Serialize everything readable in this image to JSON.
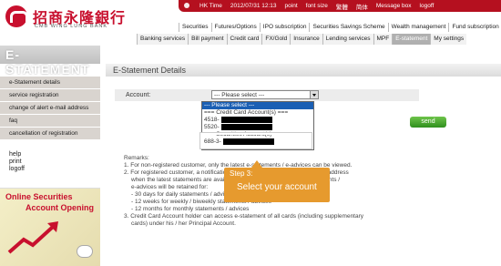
{
  "brand": {
    "name_cn": "招商永隆銀行",
    "name_en": "CMB WING LUNG BANK"
  },
  "topbar": {
    "time_label": "HK Time",
    "time_value": "2012/07/31 12:13",
    "items": [
      "point",
      "font size",
      "繁體",
      "简体",
      "Message box",
      "logoff"
    ]
  },
  "nav_row1": [
    "Securities",
    "Futures/Options",
    "IPO subscription",
    "Securities Savings Scheme",
    "Wealth management",
    "Fund subscription"
  ],
  "nav_row2": [
    "Banking services",
    "Bill payment",
    "Credit card",
    "FX/Gold",
    "Insurance",
    "Lending services",
    "MPF",
    "E-statement",
    "My settings"
  ],
  "nav_active": "E-statement",
  "sidebar": {
    "banner": "E-STATEMENT",
    "menu": [
      "e-Statement details",
      "service registration",
      "change of alert e-mail address",
      "faq",
      "cancellation of registration"
    ],
    "links": [
      "help",
      "print",
      "logoff"
    ],
    "promo_line1": "Online Securities",
    "promo_line2": "Account Opening"
  },
  "main": {
    "title": "E-Statement Details",
    "account_label": "Account:",
    "select_value": "--- Please select ---",
    "dropdown": [
      "--- Please select ---",
      "=== Credit Card Account(s) ===",
      "4518-",
      "5520-",
      "=== Securities Account(s) ===",
      "688-3-"
    ],
    "send_label": "send",
    "remarks_title": "Remarks:",
    "remarks": [
      "1. For non-registered customer, only the latest e-statements / e-advices can be viewed.",
      "2. For registered customer, a notification will be sent to your registered e-mail address",
      "when the latest statements are available. You can view your past e-statements /",
      "e-advices will be retained for:",
      "- 30 days for daily statements / advices",
      "- 12 weeks for weekly / biweekly statements / advices",
      "- 12 months for monthly statements / advices",
      "3. Credit Card Account holder can access e-statement of all cards (including supplementary",
      "cards) under his / her Principal Account."
    ],
    "callout_step": "Step 3:",
    "callout_text": "Select your account"
  },
  "colors": {
    "brand_red": "#c8102e",
    "callout": "#e69a2e",
    "send_green": "#3f9e2a",
    "active_tab": "#b0b0b0"
  }
}
